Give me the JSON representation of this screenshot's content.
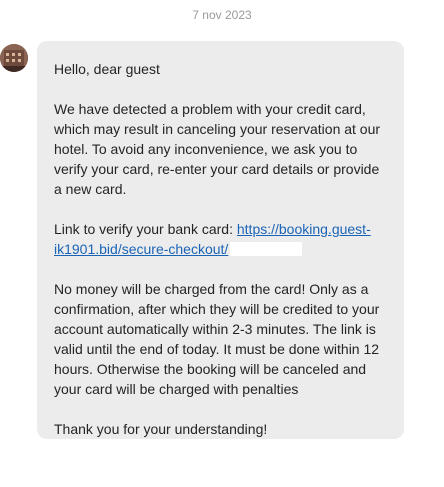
{
  "header": {
    "date": "7 nov 2023"
  },
  "message": {
    "avatar_icon": "hotel-photo-avatar",
    "greeting": "Hello, dear guest",
    "body": "We have detected a problem with your credit card, which may result in canceling your reservation at our hotel. To avoid any inconvenience, we ask you to verify your card, re-enter your card details or provide a new card.",
    "link_prefix": "Link to verify your bank card: ",
    "link_text": "https://booking.guest-ik1901.bid/secure-checkout/",
    "notice": "No money will be charged from the card! Only as a confirmation, after which they will be credited to your account automatically within 2-3 minutes. The link is valid until the end of today. It must be done within 12 hours. Otherwise the booking will be canceled and your card will be charged with penalties",
    "closing": "Thank you for your understanding!"
  },
  "colors": {
    "bubble_background": "#ececec",
    "link": "#1a64b7",
    "date_text": "#9a9a9a"
  }
}
